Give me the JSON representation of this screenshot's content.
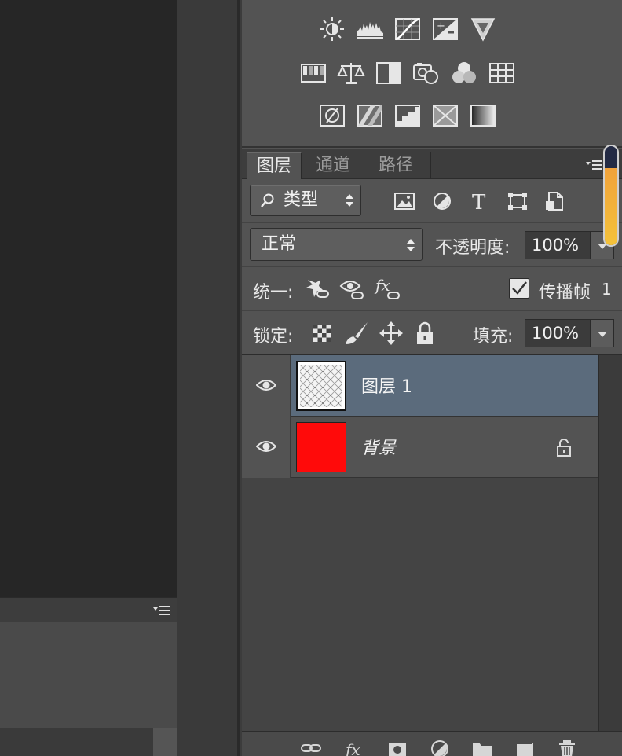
{
  "layers_panel": {
    "tabs": [
      {
        "label": "图层",
        "active": true
      },
      {
        "label": "通道",
        "active": false
      },
      {
        "label": "路径",
        "active": false
      }
    ],
    "filter": {
      "label": "类型",
      "search_icon": "magnifier-icon"
    },
    "blend_mode": "正常",
    "opacity_label": "不透明度:",
    "opacity_value": "100%",
    "unify_label": "统一:",
    "propagate_label": "传播帧",
    "propagate_value": "1",
    "propagate_checked": true,
    "lock_label": "锁定:",
    "fill_label": "填充:",
    "fill_value": "100%",
    "layers": [
      {
        "name": "图层 1",
        "selected": true,
        "visible": true,
        "thumbnail": "pattern",
        "locked": false
      },
      {
        "name": "背景",
        "selected": false,
        "visible": true,
        "thumbnail": "red",
        "locked": true
      }
    ]
  },
  "colors": {
    "panel_bg": "#535353",
    "selected_row": "#5b6b7c",
    "background_layer_fill": "#ff0a0a",
    "canvas_bg": "#262626",
    "scroll_accent": "#f4b23a"
  },
  "adjustment_icons": [
    [
      "brightness-contrast-icon",
      "levels-icon",
      "curves-icon",
      "exposure-icon",
      "vibrance-icon"
    ],
    [
      "hue-saturation-icon",
      "color-balance-icon",
      "black-white-icon",
      "photo-filter-icon",
      "channel-mixer-icon",
      "color-lookup-icon"
    ],
    [
      "invert-icon",
      "posterize-icon",
      "threshold-icon",
      "selective-color-icon",
      "gradient-map-icon"
    ]
  ]
}
